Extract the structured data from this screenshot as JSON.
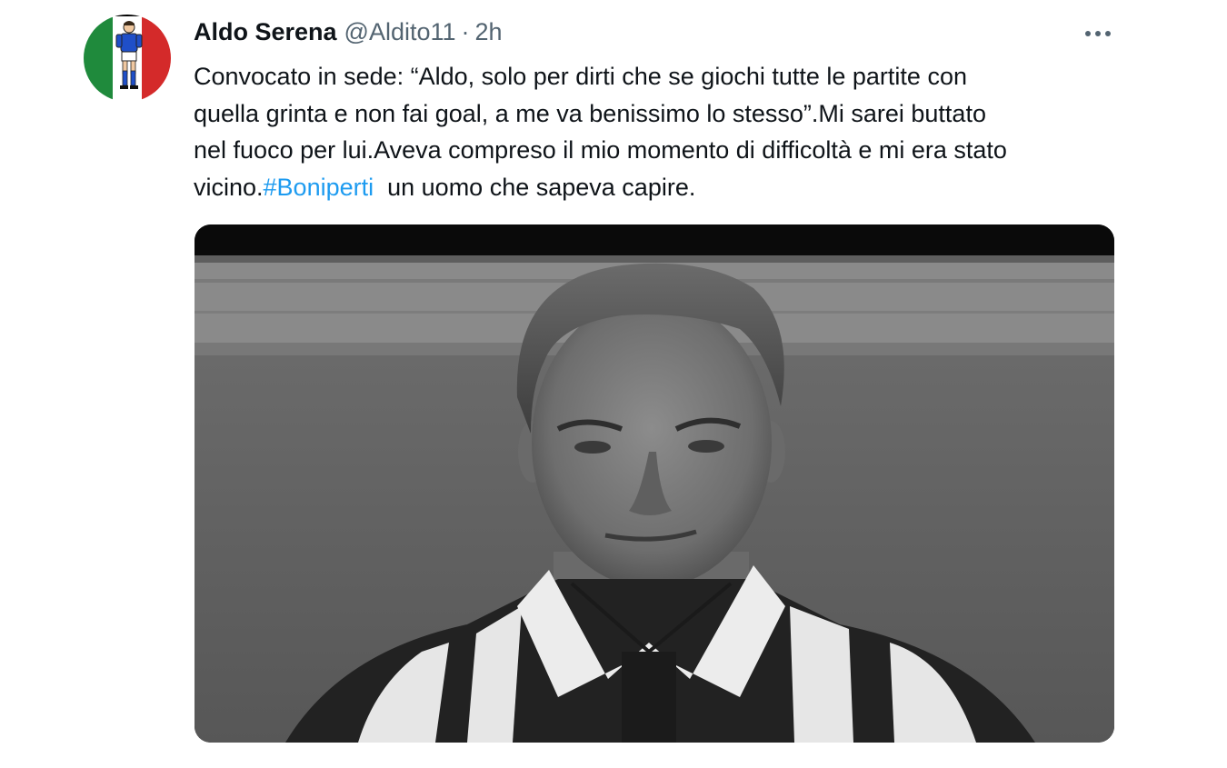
{
  "tweet": {
    "author_name": "Aldo Serena",
    "handle": "@Aldito11",
    "separator": "·",
    "time": "2h",
    "text_lines": [
      "Convocato in sede: “Aldo, solo per dirti che se giochi tutte le partite con",
      "quella grinta e non fai goal, a me va benissimo lo stesso”.Mi sarei buttato",
      "nel fuoco per lui.Aveva compreso il mio momento di difficoltà e mi era stato"
    ],
    "last_line_prefix": "vicino.",
    "hashtag": "#Boniperti",
    "last_line_suffix": "  un uomo che sapeva capire.",
    "hashtag_color": "#1d9bf0",
    "more_icon": "more-dots-icon",
    "avatar_icon": "avatar-footballer-italian-flag",
    "media_description_icon": "black-and-white-portrait-photo"
  }
}
